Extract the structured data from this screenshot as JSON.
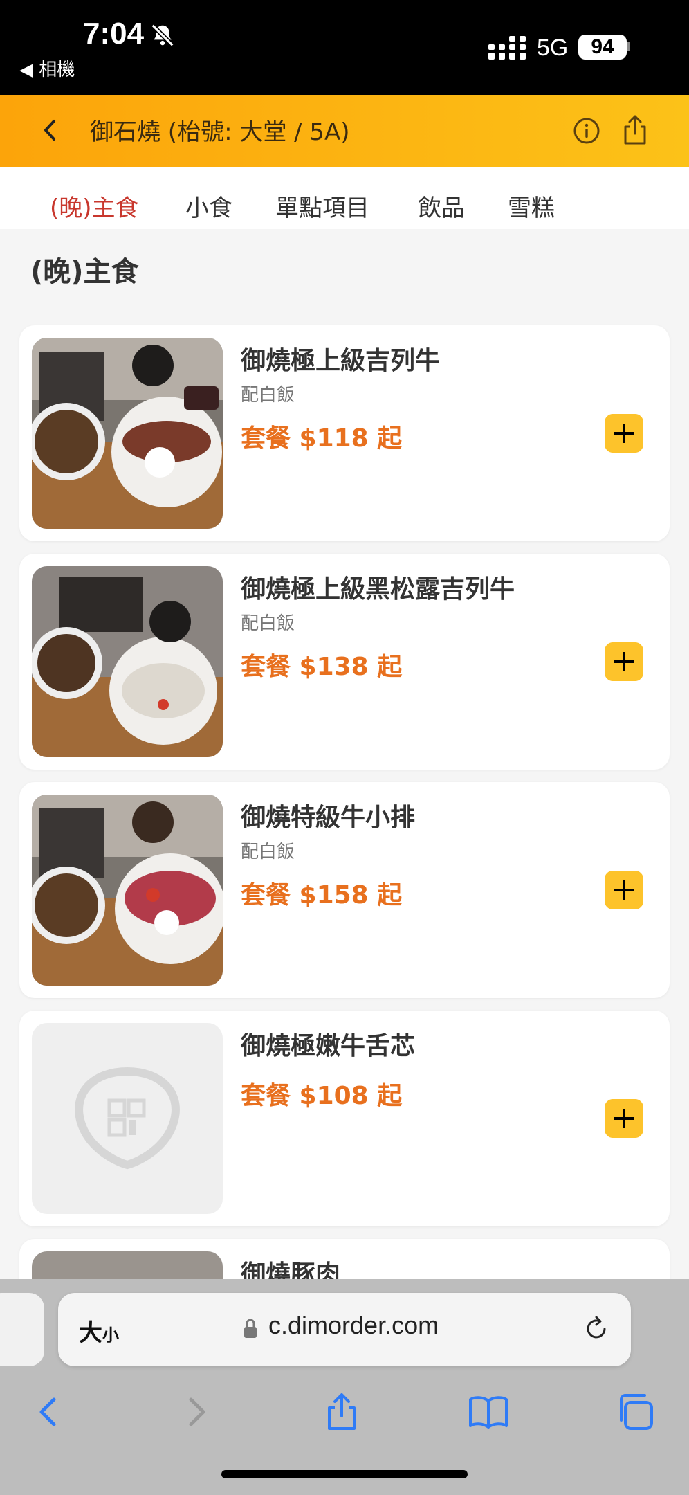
{
  "status_bar": {
    "time": "7:04",
    "back_app": "◀ 相機",
    "network": "5G",
    "battery": "94"
  },
  "header": {
    "title": "御石燒 (枱號: 大堂 / 5A)"
  },
  "tabs": [
    "(晚)主食",
    "小食",
    "單點項目",
    "飲品",
    "雪糕"
  ],
  "section_title": "(晚)主食",
  "items": [
    {
      "name": "御燒極上級吉列牛",
      "sub": "配白飯",
      "price": "套餐  $118  起"
    },
    {
      "name": "御燒極上級黑松露吉列牛",
      "sub": "配白飯",
      "price": "套餐  $138  起"
    },
    {
      "name": "御燒特級牛小排",
      "sub": "配白飯",
      "price": "套餐  $158  起"
    },
    {
      "name": "御燒極嫩牛舌芯",
      "sub": "",
      "price": "套餐  $108  起"
    },
    {
      "name": "御燒豚肉",
      "sub": "",
      "price": ""
    }
  ],
  "safari": {
    "text_size": "大",
    "text_size_small": "小",
    "url": "c.dimorder.com"
  },
  "colors": {
    "header_start": "#fca40a",
    "header_end": "#fcc218",
    "active_tab": "#c8372d",
    "price": "#e8701e",
    "add_button": "#fdc32b",
    "safari_blue": "#2f7bf6"
  }
}
